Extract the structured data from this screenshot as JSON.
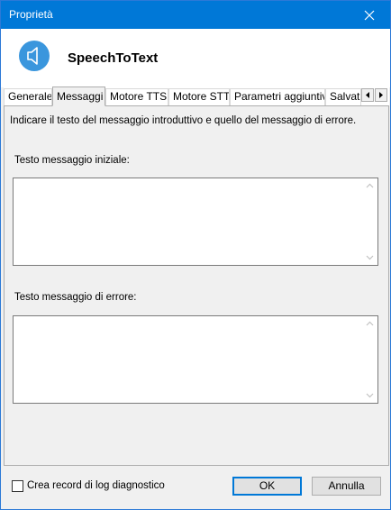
{
  "window": {
    "title": "Proprietà"
  },
  "header": {
    "app_name": "SpeechToText"
  },
  "tabs": [
    {
      "label": "Generale"
    },
    {
      "label": "Messaggi"
    },
    {
      "label": "Motore TTS"
    },
    {
      "label": "Motore STT"
    },
    {
      "label": "Parametri aggiuntivi"
    },
    {
      "label": "Salvata"
    }
  ],
  "panel": {
    "intro": "Indicare il testo del messaggio introduttivo e quello del messaggio di errore.",
    "initial_label": "Testo messaggio iniziale:",
    "initial_value": "",
    "error_label": "Testo messaggio di errore:",
    "error_value": ""
  },
  "footer": {
    "log_checkbox_label": "Crea record di log diagnostico",
    "log_checked": false,
    "ok_label": "OK",
    "cancel_label": "Annulla"
  },
  "colors": {
    "accent": "#0078d7",
    "icon": "#3a96dd"
  }
}
